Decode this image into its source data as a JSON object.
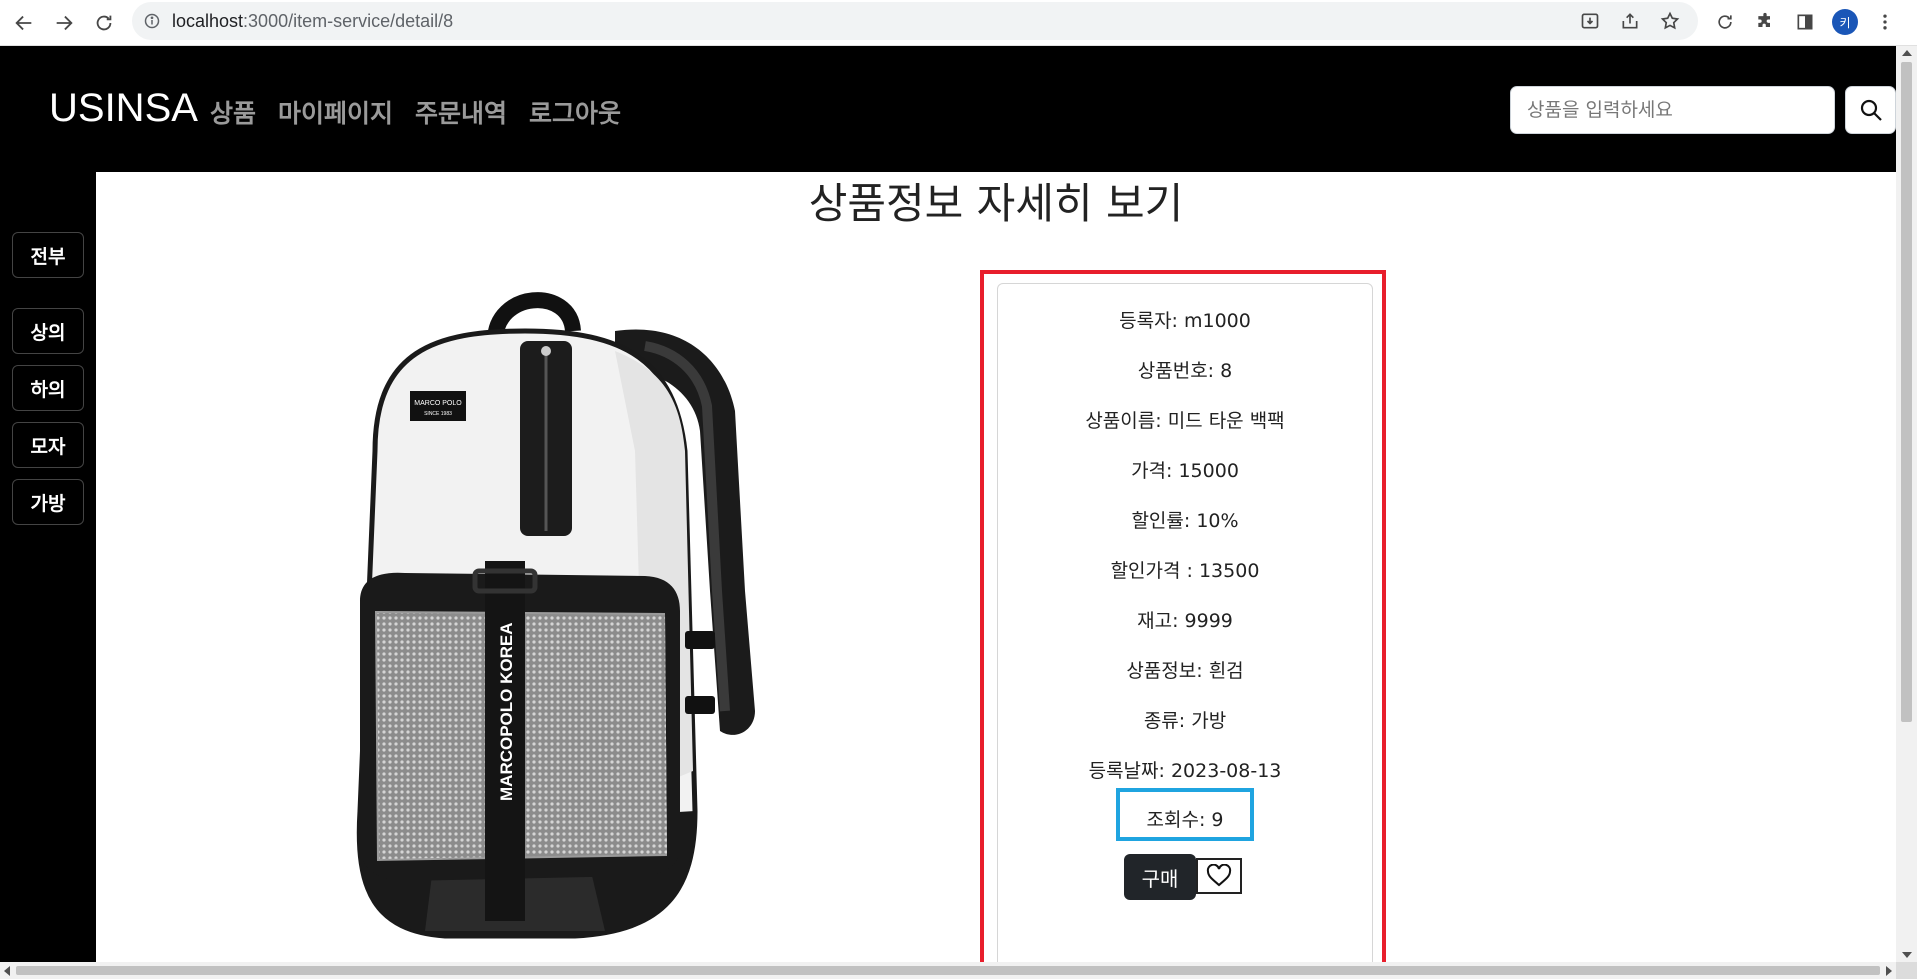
{
  "browser": {
    "url_host": "localhost",
    "url_rest": ":3000/item-service/detail/8",
    "profile_initial": "키",
    "icons": [
      "back-icon",
      "forward-icon",
      "reload-icon",
      "info-icon",
      "install-icon",
      "share-icon",
      "star-icon",
      "extension-refresh-icon",
      "puzzle-icon",
      "side-panel-icon",
      "more-icon"
    ]
  },
  "header": {
    "brand": "USINSA",
    "menu": [
      "상품",
      "마이페이지",
      "주문내역",
      "로그아웃"
    ],
    "search_placeholder": "상품을 입력하세요"
  },
  "sidebar": {
    "categories": [
      "전부",
      "상의",
      "하의",
      "모자",
      "가방"
    ]
  },
  "page": {
    "title": "상품정보 자세히 보기"
  },
  "product": {
    "image_brand": "MARCO POLO",
    "image_since": "SINCE 1983",
    "image_strap_text": "MARCOPOLO KOREA",
    "rows": [
      {
        "label": "등록자: ",
        "value": "m1000"
      },
      {
        "label": "상품번호: ",
        "value": "8"
      },
      {
        "label": "상품이름: ",
        "value": "미드 타운 백팩"
      },
      {
        "label": "가격: ",
        "value": "15000"
      },
      {
        "label": "할인률: ",
        "value": "10%"
      },
      {
        "label": "할인가격 : ",
        "value": "13500"
      },
      {
        "label": "재고: ",
        "value": "9999"
      },
      {
        "label": "상품정보: ",
        "value": "흰검"
      },
      {
        "label": "종류: ",
        "value": "가방"
      },
      {
        "label": "등록날짜: ",
        "value": "2023-08-13"
      },
      {
        "label": "조회수: ",
        "value": "9"
      }
    ],
    "buy_label": "구매"
  },
  "colors": {
    "header_bg": "#000000",
    "highlight_red": "#e81e2c",
    "highlight_blue": "#1fa4e0",
    "buy_button": "#212529"
  }
}
